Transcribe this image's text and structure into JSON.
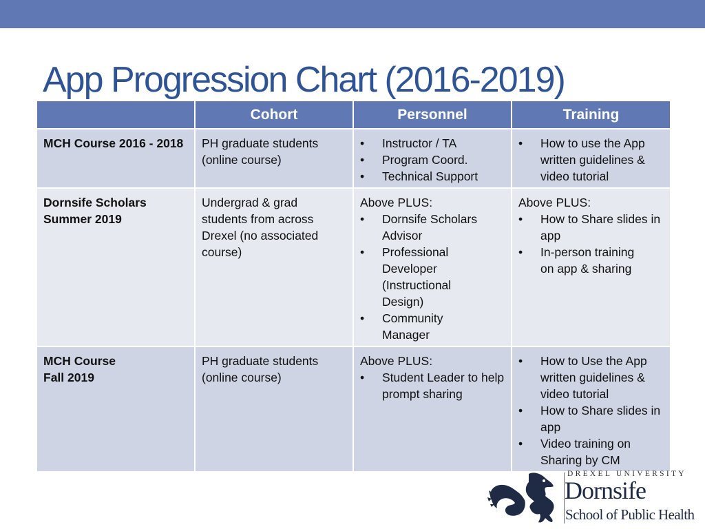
{
  "slide": {
    "title": "App Progression Chart (2016-2019)",
    "colors": {
      "accent": "#6079b5",
      "title_text": "#2f5496",
      "row_dark": "#cfd4e4",
      "row_light": "#e7e9f0",
      "logo_navy": "#1f2a44"
    }
  },
  "table": {
    "headers": [
      "",
      "Cohort",
      "Personnel",
      "Training"
    ],
    "rows": [
      {
        "label": "MCH Course 2016 - 2018",
        "cohort": "PH graduate students (online course)",
        "personnel": {
          "lead": "",
          "items": [
            "Instructor / TA",
            "Program Coord.",
            "Technical Support"
          ]
        },
        "training": {
          "lead": "",
          "items": [
            "How to use the App written guidelines & video tutorial"
          ]
        }
      },
      {
        "label": "Dornsife Scholars Summer 2019",
        "cohort": "Undergrad & grad students from across Drexel (no associated course)",
        "personnel": {
          "lead": "Above PLUS:",
          "items": [
            "Dornsife Scholars Advisor",
            "Professional Developer (Instructional Design)",
            "Community Manager"
          ]
        },
        "training": {
          "lead": "Above PLUS:",
          "items": [
            "How to Share slides in app",
            "In-person training on app & sharing"
          ]
        }
      },
      {
        "label": "MCH Course Fall 2019",
        "cohort": "PH graduate students (online course)",
        "personnel": {
          "lead": "Above PLUS:",
          "items": [
            "Student Leader to help prompt sharing"
          ]
        },
        "training": {
          "lead": "",
          "items": [
            "How to Use the App written guidelines & video tutorial",
            "How to Share slides in app",
            "Video training on Sharing by CM"
          ]
        }
      }
    ],
    "bullet": "•"
  },
  "logo": {
    "icon": "dragon-icon",
    "university": "DREXEL UNIVERSITY",
    "school": "Dornsife",
    "subtitle": "School of Public Health"
  }
}
